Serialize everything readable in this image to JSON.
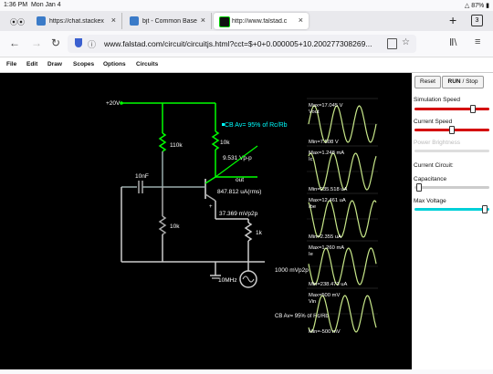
{
  "statusbar": {
    "time": "1:36 PM",
    "date": "Mon Jan 4",
    "battery": "87%"
  },
  "tabs": [
    {
      "label": "",
      "icon": "mask-icon"
    },
    {
      "label": "https://chat.stackex",
      "icon": "stackexchange-icon"
    },
    {
      "label": "bjt - Common Base",
      "icon": "stackexchange-icon"
    },
    {
      "label": "http://www.falstad.c",
      "icon": "falstad-icon"
    }
  ],
  "tab_count": "3",
  "url": "www.falstad.com/circuit/circuitjs.html?cct=$+0+0.000005+10.200277308269...",
  "menu": [
    "File",
    "Edit",
    "Draw",
    "Scopes",
    "Options",
    "Circuits"
  ],
  "sidebar": {
    "reset_label": "Reset",
    "run_label": "RUN",
    "stop_label": "/ Stop",
    "simulation_speed_label": "Simulation Speed",
    "current_speed_label": "Current Speed",
    "power_brightness_label": "Power Brightness",
    "current_circuit_label": "Current Circuit:",
    "capacitance_label": "Capacitance",
    "max_voltage_label": "Max Voltage",
    "simulation_speed": 0.8,
    "current_speed": 0.5,
    "capacitance": 0.02,
    "max_voltage": 0.98
  },
  "circuit": {
    "supply_label": "+20V",
    "r_top_label": "110k",
    "r_collector_label": "10k",
    "vpp_label": "9.531 Vp-p",
    "cap_label": "10nF",
    "out_label": "out",
    "current_label": "847.812 uA(rms)",
    "r_bottom_label": "10k",
    "emitter_vpp_label": "37.369 mVp2p",
    "r_emitter_label": "1k",
    "source_label": "10MHz",
    "source_vpp_label": "1000 mVp2p",
    "title_label": "CB Av= 95% of Rc/Rb",
    "bottom_label": "CB Av= 95% of Rc/Rb"
  },
  "scopes": [
    {
      "max": "Max=17.045 V",
      "name": "Vout",
      "min": "Min=7.508 V"
    },
    {
      "max": "Max=1.248 mA",
      "name": "Ic",
      "min": "Min=235.518 uA"
    },
    {
      "max": "Max=12.461 uA",
      "name": "Ibe",
      "min": "Min=2.355 uA"
    },
    {
      "max": "Max=1.260 mA",
      "name": "Ie",
      "min": "Min=238.473 uA"
    },
    {
      "max": "Max=500 mV",
      "name": "Vin",
      "min": "Min=-500 mV"
    }
  ],
  "colors": {
    "wire_high": "#00ff00",
    "wire_mid": "#7a7a7a",
    "wire_low": "#d8d8d8",
    "scope_trace": "#c8e88a",
    "sim_track": "#d40000",
    "max_voltage_track": "#00d0d8",
    "title_cyan": "#00ffff"
  }
}
